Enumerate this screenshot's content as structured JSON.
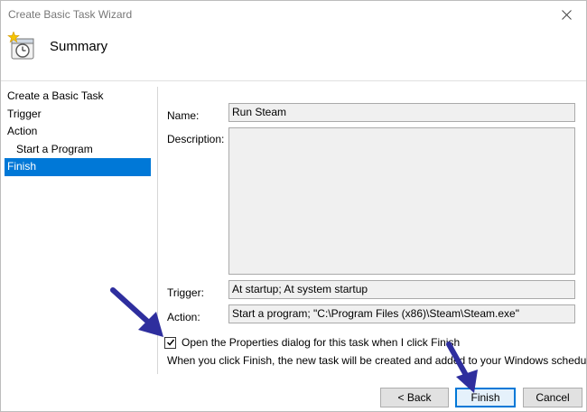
{
  "window": {
    "title": "Create Basic Task Wizard"
  },
  "header": {
    "title": "Summary",
    "icon": "task-scheduler-clock-icon"
  },
  "steps": [
    {
      "label": "Create a Basic Task",
      "sub": false,
      "active": false
    },
    {
      "label": "Trigger",
      "sub": false,
      "active": false
    },
    {
      "label": "Action",
      "sub": false,
      "active": false
    },
    {
      "label": "Start a Program",
      "sub": true,
      "active": false
    },
    {
      "label": "Finish",
      "sub": false,
      "active": true
    }
  ],
  "form": {
    "name_label": "Name:",
    "name_value": "Run Steam",
    "description_label": "Description:",
    "description_value": "",
    "trigger_label": "Trigger:",
    "trigger_value": "At startup; At system startup",
    "action_label": "Action:",
    "action_value": "Start a program; \"C:\\Program Files (x86)\\Steam\\Steam.exe\""
  },
  "options": {
    "open_properties_label": "Open the Properties dialog for this task when I click Finish",
    "open_properties_checked": true,
    "note": "When you click Finish, the new task will be created and added to your Windows schedule."
  },
  "buttons": {
    "back": "< Back",
    "finish": "Finish",
    "cancel": "Cancel"
  },
  "colors": {
    "selection": "#0078d7",
    "annotation_arrow": "#2e2e9e"
  }
}
